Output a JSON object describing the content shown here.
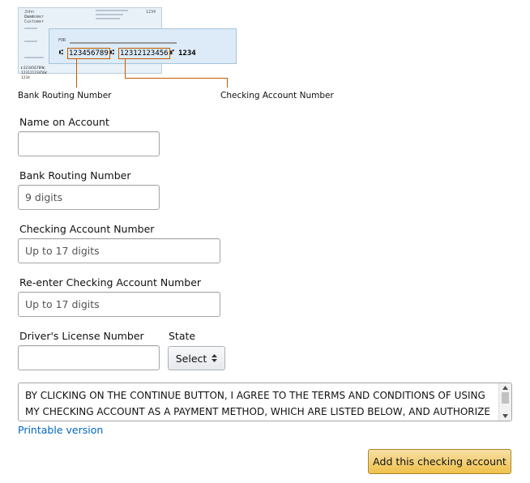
{
  "check": {
    "name_line1": "John Customer",
    "name_line2": "Jane Customer",
    "check_number": "1234",
    "for_label": "FOR",
    "routing_sample": "123456789",
    "account_sample": "12312123456",
    "check_num_micr": "1234",
    "back_micr": "⑆123456789⑆ 12312123456⑈ 1234"
  },
  "captions": {
    "routing": "Bank Routing Number",
    "account": "Checking Account Number"
  },
  "form": {
    "name_label": "Name on Account",
    "name_value": "",
    "routing_label": "Bank Routing Number",
    "routing_placeholder": "9 digits",
    "account_label": "Checking Account Number",
    "account_placeholder": "Up to 17 digits",
    "reenter_label": "Re-enter Checking Account Number",
    "reenter_placeholder": "Up to 17 digits",
    "license_label": "Driver's License Number",
    "license_value": "",
    "state_label": "State",
    "state_selected": "Select"
  },
  "terms": {
    "text": "BY CLICKING ON THE CONTINUE BUTTON, I AGREE TO THE TERMS AND CONDITIONS OF USING MY CHECKING ACCOUNT AS A PAYMENT METHOD, WHICH ARE LISTED BELOW, AND AUTHORIZE AMAZON.COM OR ITS AFFILIATES TO DEBIT MY ACCOUNT FOR PURCHASES I MAKE USING THIS PAYMENT METHOD."
  },
  "links": {
    "printable": "Printable version"
  },
  "buttons": {
    "add": "Add this checking account"
  },
  "colors": {
    "callout": "#c45a00",
    "link": "#0066c0",
    "button": "#f0c14b"
  }
}
